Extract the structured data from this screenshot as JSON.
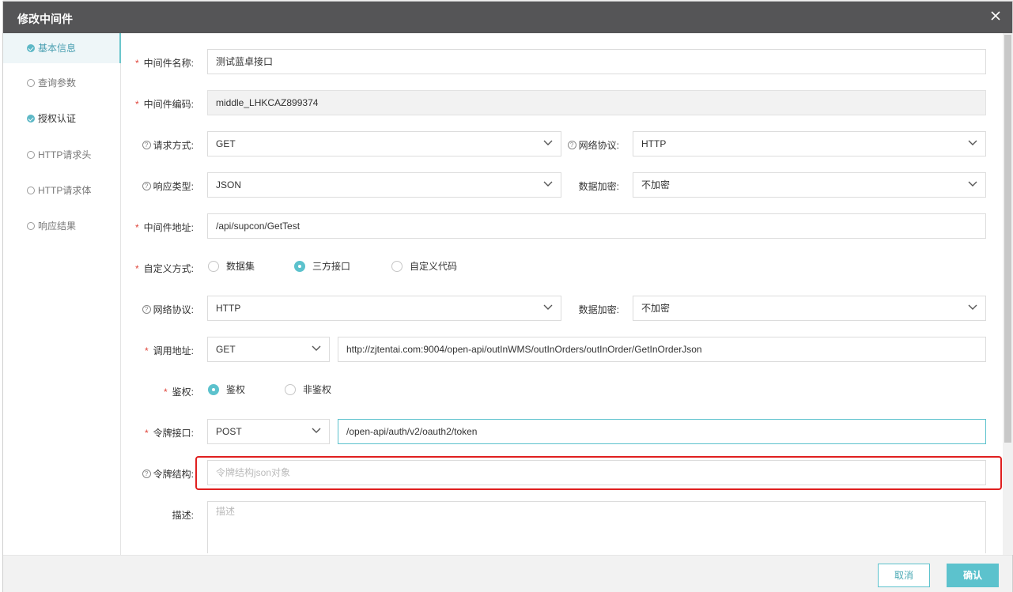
{
  "dialog": {
    "title": "修改中间件"
  },
  "sidebar": {
    "items": [
      {
        "label": "基本信息",
        "state": "active"
      },
      {
        "label": "查询参数",
        "state": "empty"
      },
      {
        "label": "授权认证",
        "state": "done"
      },
      {
        "label": "HTTP请求头",
        "state": "empty"
      },
      {
        "label": "HTTP请求体",
        "state": "empty"
      },
      {
        "label": "响应结果",
        "state": "empty"
      }
    ]
  },
  "form": {
    "name_label": "中间件名称:",
    "name_value": "测试蓝卓接口",
    "code_label": "中间件编码:",
    "code_value": "middle_LHKCAZ899374",
    "method_label": "请求方式:",
    "method_value": "GET",
    "protocol_label": "网络协议:",
    "protocol_value": "HTTP",
    "response_type_label": "响应类型:",
    "response_type_value": "JSON",
    "encrypt_label": "数据加密:",
    "encrypt_value": "不加密",
    "address_label": "中间件地址:",
    "address_value": "/api/supcon/GetTest",
    "custom_label": "自定义方式:",
    "custom_options": [
      "数据集",
      "三方接口",
      "自定义代码"
    ],
    "custom_selected": 1,
    "protocol2_label": "网络协议:",
    "protocol2_value": "HTTP",
    "encrypt2_label": "数据加密:",
    "encrypt2_value": "不加密",
    "call_label": "调用地址:",
    "call_method": "GET",
    "call_url": "http://zjtentai.com:9004/open-api/outInWMS/outInOrders/outInOrder/GetInOrderJson",
    "auth_label": "鉴权:",
    "auth_options": [
      "鉴权",
      "非鉴权"
    ],
    "auth_selected": 0,
    "token_label": "令牌接口:",
    "token_method": "POST",
    "token_url": "/open-api/auth/v2/oauth2/token",
    "token_struct_label": "令牌结构:",
    "token_struct_placeholder": "令牌结构json对象",
    "desc_label": "描述:",
    "desc_placeholder": "描述"
  },
  "footer": {
    "cancel_label": "取消",
    "ok_label": "确认"
  },
  "colors": {
    "accent": "#5cc2cd",
    "titlebar": "#555557",
    "highlight": "#e02020",
    "required": "#e0463c"
  }
}
